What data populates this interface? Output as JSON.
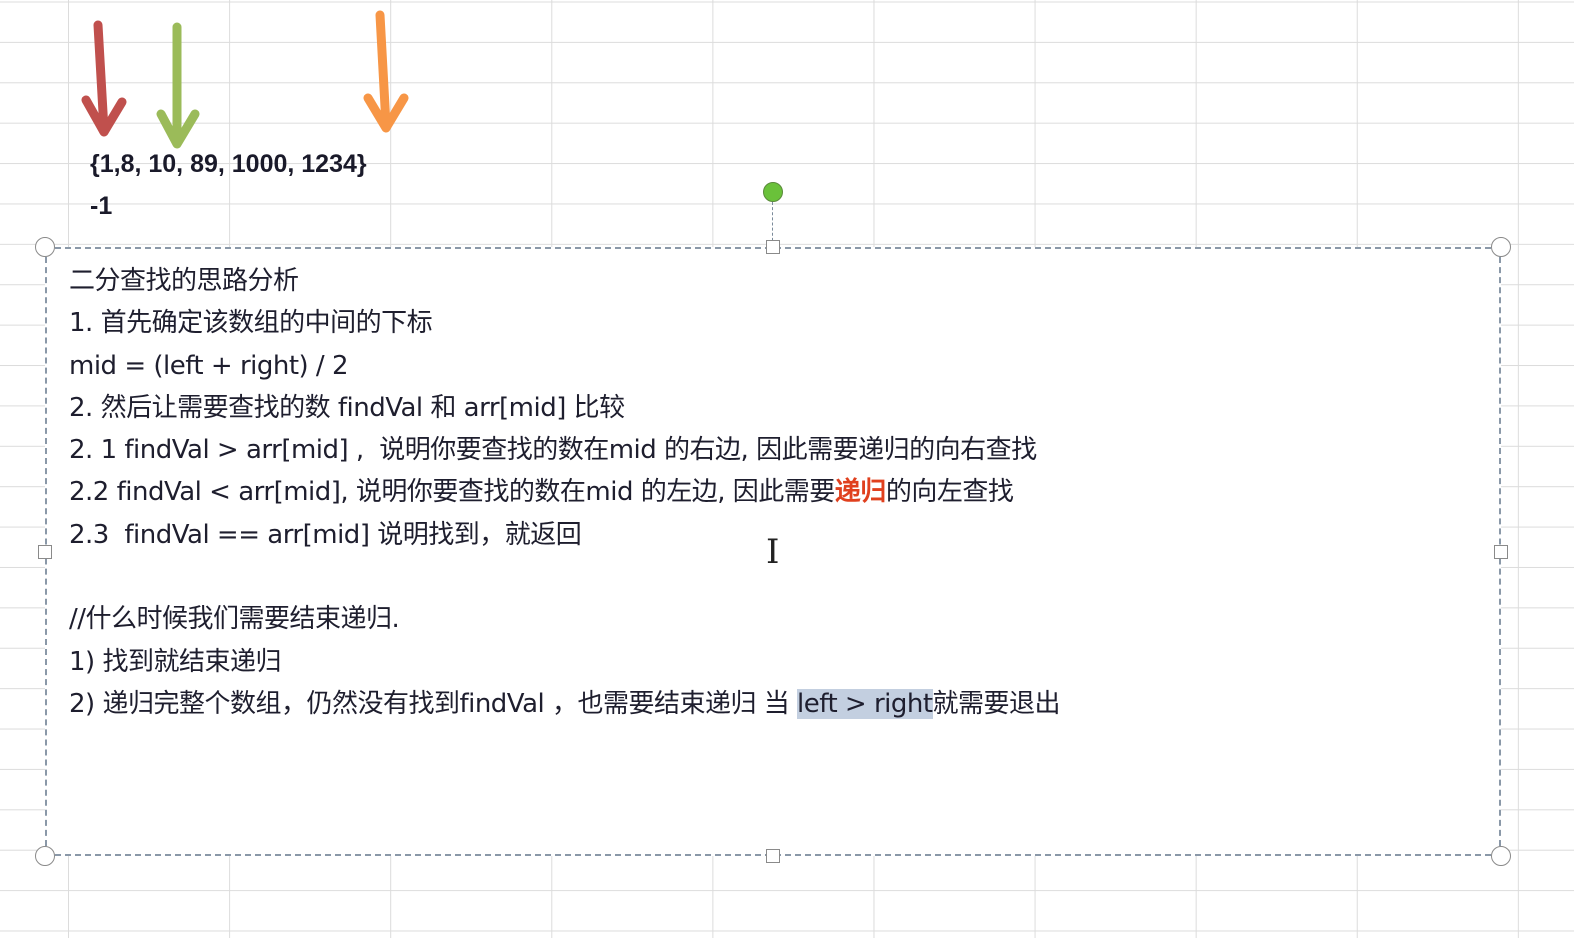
{
  "sheet": {
    "array_text": "{1,8, 10, 89, 1000, 1234}",
    "result_text": "-1",
    "arrow_colors": {
      "left": "#c0504d",
      "mid": "#9bbb59",
      "right": "#f79646"
    }
  },
  "textbox": {
    "lines": [
      [
        {
          "t": "二分查找的思路分析"
        }
      ],
      [
        {
          "t": "1. 首先确定该数组的中间的下标"
        }
      ],
      [
        {
          "t": "mid = (left + right) / 2"
        }
      ],
      [
        {
          "t": "2. 然后让需要查找的数 findVal 和 arr[mid] 比较"
        }
      ],
      [
        {
          "t": "2. 1 findVal > arr[mid] ,  说明你要查找的数在mid 的右边, 因此需要递归的向右查找"
        }
      ],
      [
        {
          "t": "2.2 findVal < arr[mid], 说明你要查找的数在mid 的左边, 因此需要"
        },
        {
          "t": "递归",
          "s": "red"
        },
        {
          "t": "的向左查找"
        }
      ],
      [
        {
          "t": "2.3  findVal == arr[mid] 说明找到，就返回"
        }
      ],
      [
        {
          "t": ""
        }
      ],
      [
        {
          "t": "//什么时候我们需要结束递归."
        }
      ],
      [
        {
          "t": "1) 找到就结束递归"
        }
      ],
      [
        {
          "t": "2) 递归完整个数组，仍然没有找到findVal ，也需要结束递归 当 "
        },
        {
          "t": "left > right",
          "s": "hl"
        },
        {
          "t": "就需要退出"
        }
      ]
    ]
  }
}
